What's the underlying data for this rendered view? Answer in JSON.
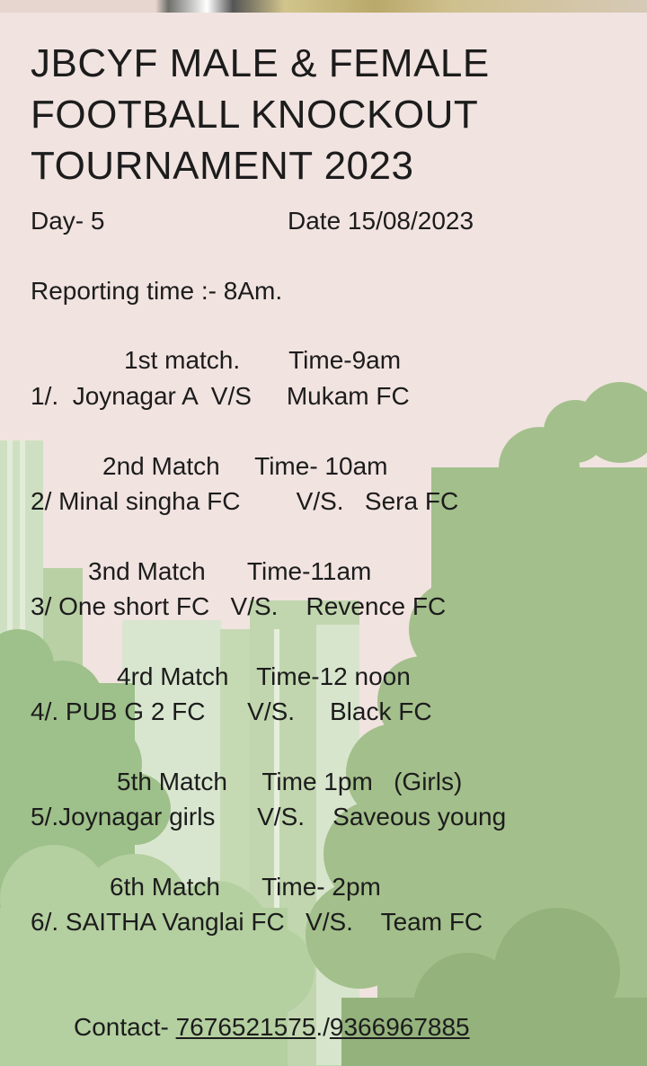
{
  "title": "JBCYF MALE & FEMALE FOOTBALL KNOCKOUT TOURNAMENT 2023",
  "day": "Day- 5",
  "date": "Date 15/08/2023",
  "reporting": "Reporting time :- 8Am.",
  "matches": [
    {
      "header": "1st match.       Time-9am",
      "teams": "1/.  Joynagar A  V/S     Mukam FC"
    },
    {
      "header": "2nd Match     Time- 10am",
      "teams": "2/ Minal singha FC        V/S.   Sera FC"
    },
    {
      "header": "3nd Match      Time-11am",
      "teams": "3/ One short FC   V/S.    Revence FC"
    },
    {
      "header": "4rd Match    Time-12 noon",
      "teams": "4/. PUB G 2 FC      V/S.     Black FC"
    },
    {
      "header": "5th Match     Time 1pm   (Girls)",
      "teams": "5/.Joynagar girls      V/S.    Saveous young"
    },
    {
      "header": "6th Match      Time- 2pm",
      "teams": "6/. SAITHA Vanglai FC   V/S.    Team FC"
    }
  ],
  "contact": {
    "prefix": "Contact- ",
    "phone1": "7676521575",
    "separator": "./",
    "phone2": "9366967885"
  }
}
